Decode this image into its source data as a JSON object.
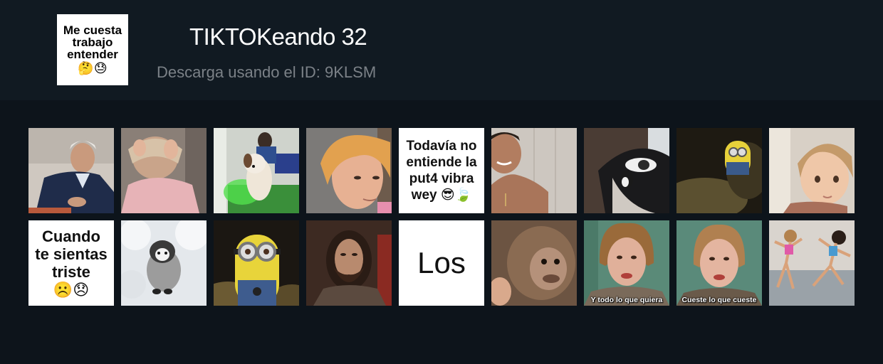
{
  "pack": {
    "thumbnail_lines": [
      "Me cuesta",
      "trabajo",
      "entender"
    ],
    "thumbnail_emoji": "🤔😓",
    "title": "TIKTOKeando 32",
    "download_text": "Descarga usando el ID: 9KLSM"
  },
  "stickers": {
    "s5_lines": [
      "Todavía no",
      "entiende la",
      "put4 vibra",
      "wey 😎🍃"
    ],
    "s10_lines": [
      "Cuando",
      "te sientas",
      "triste"
    ],
    "s10_emoji": "☹️😞",
    "s14_text": "Los",
    "s16_caption": "Y todo lo que quiera",
    "s17_caption": "Cueste lo que cueste"
  },
  "colors": {
    "background": "#0d141b",
    "header": "#111a22",
    "title": "#ffffff",
    "subtitle": "#7b8187"
  }
}
